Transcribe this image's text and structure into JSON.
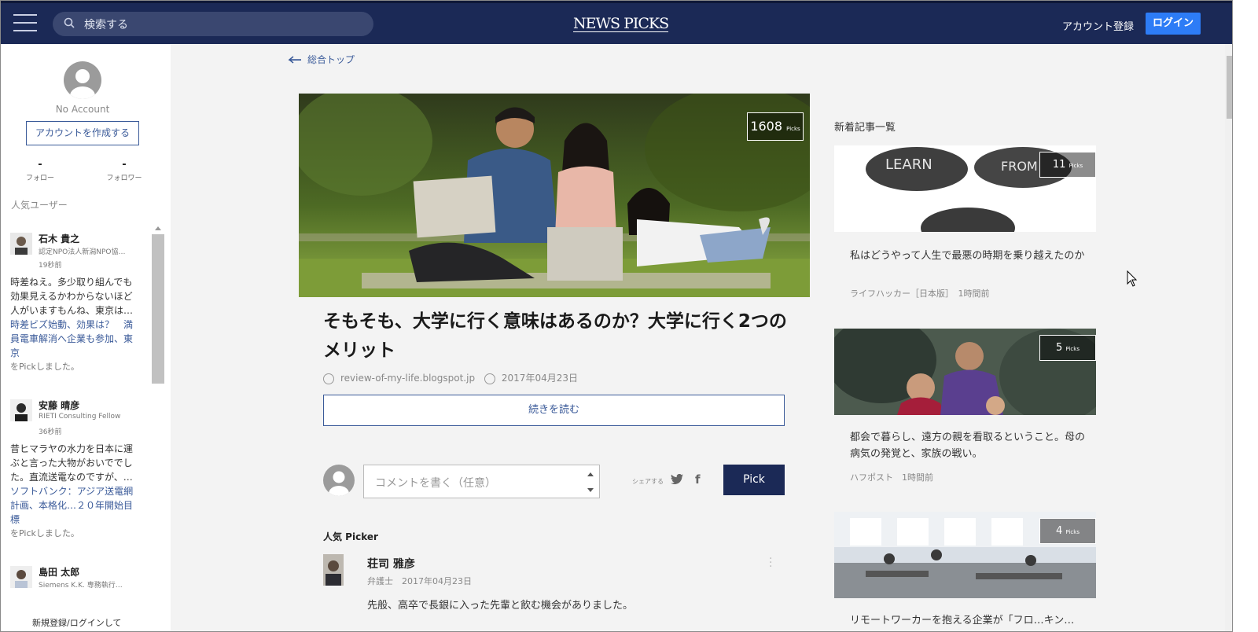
{
  "header": {
    "search_placeholder": "検索する",
    "logo": "NEWS PICKS",
    "register": "アカウント登録",
    "login": "ログイン"
  },
  "sidebar": {
    "no_account": "No Account",
    "create_account": "アカウントを作成する",
    "follow_value": "-",
    "follow_label": "フォロー",
    "follower_value": "-",
    "follower_label": "フォロワー",
    "popular_users": "人気ユーザー",
    "users": [
      {
        "name": "石木 貴之",
        "title": "認定NPO法人新潟NPO協…",
        "time": "19秒前",
        "comment": "時差ねえ。多少取り組んでも効果見えるかわからないほど人がいますもんね、東京は…",
        "link": "時差ビズ始動、効果は？　満員電車解消へ企業も参加、東京",
        "picked": "をPickしました。"
      },
      {
        "name": "安藤 晴彦",
        "title": "RIETI Consulting Fellow",
        "time": "36秒前",
        "comment": "昔ヒマラヤの水力を日本に運ぶと言った大物がおいででした。直流送電なのですが、…",
        "link": "ソフトバンク：アジア送電網計画、本格化…２０年開始目標",
        "picked": "をPickしました。"
      },
      {
        "name": "島田 太郎",
        "title": "Siemens K.K. 専務執行…",
        "time": "",
        "comment": "",
        "link": "",
        "picked": ""
      }
    ],
    "footer": "新規登録/ログインして"
  },
  "main": {
    "back_label": "総合トップ",
    "picks_count": "1608",
    "picks_unit": "Picks",
    "title": "そもそも、大学に行く意味はあるのか？大学に行く2つのメリット",
    "source": "review-of-my-life.blogspot.jp",
    "date": "2017年04月23日",
    "read_more": "続きを読む",
    "comment_placeholder": "コメントを書く（任意）",
    "share_label": "シェアする",
    "pick_button": "Pick",
    "popular_picker": "人気 Picker",
    "picker": {
      "name": "荘司 雅彦",
      "role": "弁護士",
      "date": "2017年04月23日",
      "comment": "先般、高卒で長銀に入った先輩と飲む機会がありました。"
    }
  },
  "right": {
    "heading": "新着記事一覧",
    "articles": [
      {
        "picks": "11",
        "unit": "Picks",
        "title": "私はどうやって人生で最悪の時期を乗り越えたのか",
        "source": "ライフハッカー［日本版］",
        "time": "1時間前"
      },
      {
        "picks": "5",
        "unit": "Picks",
        "title": "都会で暮らし、遠方の親を看取るということ。母の病気の発覚と、家族の戦い。",
        "source": "ハフポスト",
        "time": "1時間前"
      },
      {
        "picks": "4",
        "unit": "Picks",
        "title": "リモートワーカーを抱える企業が「フロ…キン…",
        "source": "",
        "time": ""
      }
    ]
  },
  "icons": [
    "menu-icon",
    "search-icon",
    "globe-icon",
    "clock-icon",
    "twitter-icon",
    "facebook-icon",
    "back-arrow-icon",
    "more-icon"
  ]
}
